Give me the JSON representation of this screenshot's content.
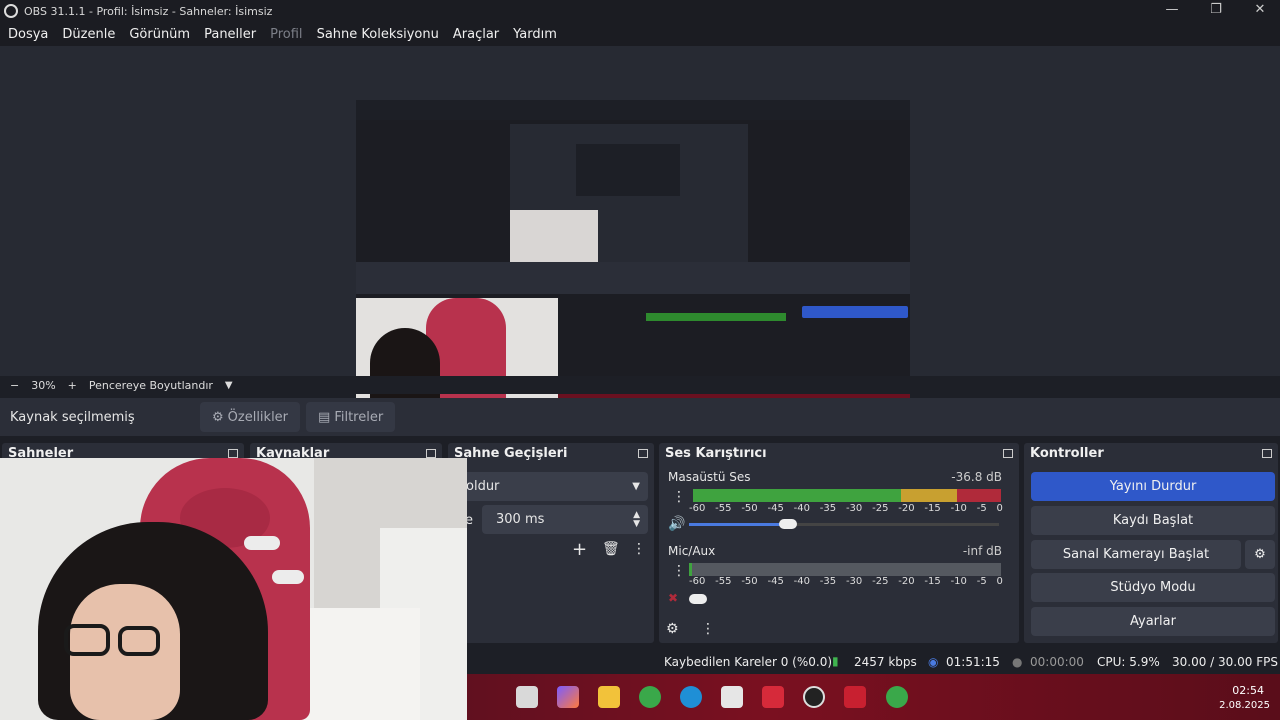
{
  "window": {
    "title": "OBS 31.1.1 - Profil: İsimsiz - Sahneler: İsimsiz"
  },
  "menu": [
    "Dosya",
    "Düzenle",
    "Görünüm",
    "Paneller",
    "Profil",
    "Sahne Koleksiyonu",
    "Araçlar",
    "Yardım"
  ],
  "zoom": {
    "minus": "−",
    "level": "30%",
    "plus": "+",
    "fit_label": "Pencereye Boyutlandır"
  },
  "source_bar": {
    "label": "Kaynak seçilmemiş",
    "properties": "Özellikler",
    "filters": "Filtreler"
  },
  "docks": {
    "scenes": "Sahneler",
    "sources": "Kaynaklar",
    "transitions": "Sahne Geçişleri",
    "mixer": "Ses Karıştırıcı",
    "controls": "Kontroller"
  },
  "transitions": {
    "type": "oldur",
    "duration_label": "re",
    "duration": "300 ms"
  },
  "mixer": {
    "channels": [
      {
        "name": "Masaüstü Ses",
        "level": "-36.8 dB"
      },
      {
        "name": "Mic/Aux",
        "level": "-inf dB"
      }
    ],
    "ticks": [
      "-60",
      "-55",
      "-50",
      "-45",
      "-40",
      "-35",
      "-30",
      "-25",
      "-20",
      "-15",
      "-10",
      "-5",
      "0"
    ]
  },
  "controls": {
    "stop_stream": "Yayını Durdur",
    "start_record": "Kaydı Başlat",
    "virtual_cam": "Sanal Kamerayı Başlat",
    "studio_mode": "Stüdyo Modu",
    "settings": "Ayarlar"
  },
  "status": {
    "dropped": "Kaybedilen Kareler 0 (%0.0)",
    "bitrate": "2457 kbps",
    "stream_time": "01:51:15",
    "record_time": "00:00:00",
    "cpu": "CPU: 5.9%",
    "fps": "30.00 / 30.00 FPS"
  },
  "taskbar": {
    "time": "02:54",
    "date": "2.08.2025"
  },
  "colors": {
    "accent": "#2f58c9",
    "bg": "#1d1f26",
    "panel": "#2b2e38"
  }
}
